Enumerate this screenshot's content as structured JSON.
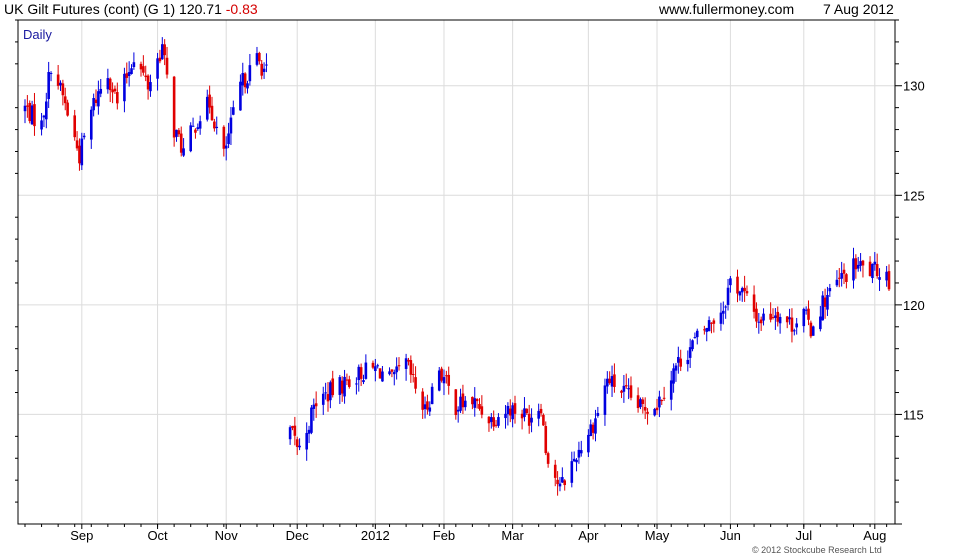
{
  "header": {
    "instrument": "UK Gilt Futures (cont) (G 1)",
    "last_price": "120.71",
    "change": "-0.83",
    "website": "www.fullermoney.com",
    "date": "7 Aug 2012"
  },
  "footer": {
    "copyright": "© 2012 Stockcube Research Ltd"
  },
  "colors": {
    "up": "#0000e0",
    "down": "#e00000",
    "grid": "#dcdcdc",
    "axis": "#000000"
  },
  "chart_data": {
    "type": "candlestick",
    "title": "",
    "subtitle": "",
    "period_label": "Daily",
    "xlabel": "",
    "ylabel": "",
    "ylim": [
      110,
      133
    ],
    "y_ticks": [
      115,
      120,
      125,
      130
    ],
    "x_ticks": [
      {
        "label": "Sep",
        "date": "2011-09-01"
      },
      {
        "label": "Oct",
        "date": "2011-10-03"
      },
      {
        "label": "Nov",
        "date": "2011-11-01"
      },
      {
        "label": "Dec",
        "date": "2011-12-01"
      },
      {
        "label": "2012",
        "date": "2012-01-03"
      },
      {
        "label": "Feb",
        "date": "2012-02-01"
      },
      {
        "label": "Mar",
        "date": "2012-03-01"
      },
      {
        "label": "Apr",
        "date": "2012-04-02"
      },
      {
        "label": "May",
        "date": "2012-05-01"
      },
      {
        "label": "Jun",
        "date": "2012-06-01"
      },
      {
        "label": "Jul",
        "date": "2012-07-02"
      },
      {
        "label": "Aug",
        "date": "2012-08-01"
      }
    ],
    "date_range": [
      "2011-08-08",
      "2012-08-07"
    ],
    "grid": true,
    "y_axis_side": "right",
    "close_path": [
      [
        "2011-08-08",
        129.0
      ],
      [
        "2011-08-15",
        128.2
      ],
      [
        "2011-08-19",
        131.0
      ],
      [
        "2011-08-24",
        129.5
      ],
      [
        "2011-08-31",
        126.8
      ],
      [
        "2011-09-06",
        129.2
      ],
      [
        "2011-09-12",
        130.6
      ],
      [
        "2011-09-16",
        129.2
      ],
      [
        "2011-09-23",
        131.4
      ],
      [
        "2011-09-29",
        130.0
      ],
      [
        "2011-10-05",
        131.8
      ],
      [
        "2011-10-10",
        128.0
      ],
      [
        "2011-10-14",
        127.0
      ],
      [
        "2011-10-20",
        128.5
      ],
      [
        "2011-10-25",
        129.2
      ],
      [
        "2011-10-31",
        126.8
      ],
      [
        "2011-11-07",
        130.0
      ],
      [
        "2011-11-14",
        131.2
      ],
      [
        "2011-11-18",
        130.6
      ],
      [
        "2011-11-28",
        114.2
      ],
      [
        "2011-12-02",
        113.4
      ],
      [
        "2011-12-09",
        115.6
      ],
      [
        "2011-12-19",
        116.3
      ],
      [
        "2011-12-28",
        116.9
      ],
      [
        "2012-01-04",
        117.1
      ],
      [
        "2012-01-10",
        116.5
      ],
      [
        "2012-01-16",
        117.3
      ],
      [
        "2012-01-24",
        115.1
      ],
      [
        "2012-01-30",
        117.1
      ],
      [
        "2012-02-06",
        115.4
      ],
      [
        "2012-02-13",
        115.6
      ],
      [
        "2012-02-21",
        114.8
      ],
      [
        "2012-02-29",
        115.3
      ],
      [
        "2012-03-08",
        114.9
      ],
      [
        "2012-03-13",
        115.5
      ],
      [
        "2012-03-15",
        113.4
      ],
      [
        "2012-03-21",
        111.6
      ],
      [
        "2012-03-28",
        113.2
      ],
      [
        "2012-04-05",
        114.8
      ],
      [
        "2012-04-10",
        116.6
      ],
      [
        "2012-04-16",
        116.1
      ],
      [
        "2012-04-24",
        115.3
      ],
      [
        "2012-05-01",
        115.5
      ],
      [
        "2012-05-09",
        117.2
      ],
      [
        "2012-05-16",
        118.2
      ],
      [
        "2012-05-22",
        119.0
      ],
      [
        "2012-05-29",
        119.9
      ],
      [
        "2012-06-01",
        121.1
      ],
      [
        "2012-06-06",
        120.6
      ],
      [
        "2012-06-13",
        119.3
      ],
      [
        "2012-06-20",
        119.7
      ],
      [
        "2012-06-27",
        119.1
      ],
      [
        "2012-07-02",
        119.6
      ],
      [
        "2012-07-05",
        118.9
      ],
      [
        "2012-07-10",
        120.1
      ],
      [
        "2012-07-17",
        121.1
      ],
      [
        "2012-07-24",
        121.8
      ],
      [
        "2012-07-31",
        121.5
      ],
      [
        "2012-08-03",
        121.6
      ],
      [
        "2012-08-06",
        121.5
      ],
      [
        "2012-08-07",
        120.71
      ]
    ],
    "gap": [
      "2011-11-21",
      "2011-11-27"
    ],
    "last_bar": {
      "date": "2012-08-07",
      "close": 120.71,
      "change": -0.83
    }
  }
}
